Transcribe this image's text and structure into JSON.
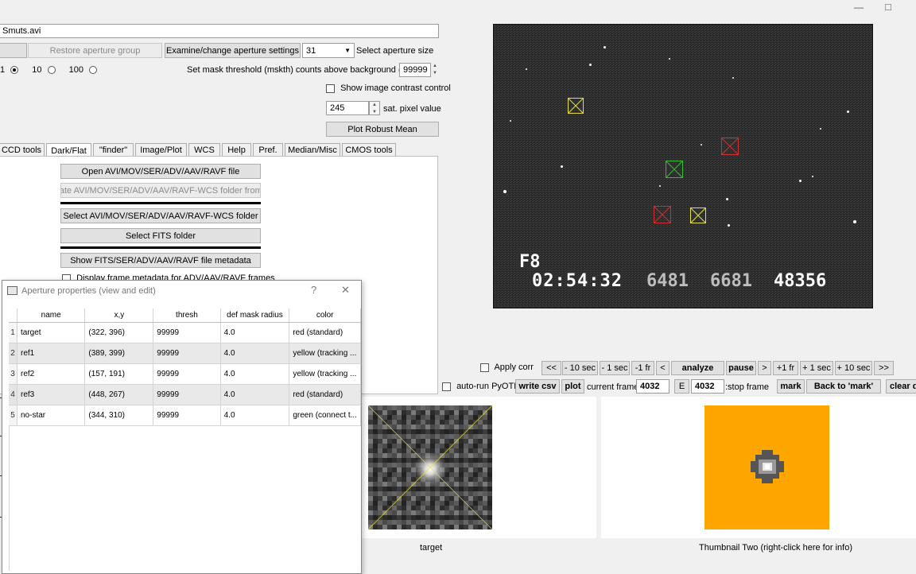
{
  "window": {
    "minimize_glyph": "—",
    "maximize_glyph": "□"
  },
  "file_field": "Smuts.avi",
  "aperture_controls": {
    "restore_group_button": "Restore aperture group",
    "examine_button": "Examine/change aperture settings",
    "size_value": "31",
    "size_label": "Select aperture size"
  },
  "scale_options": {
    "option1_label": "1",
    "option2_label": "10",
    "option3_label": "100",
    "selected": "1"
  },
  "mask": {
    "label": "Set mask threshold (mskth) counts above background (bkavg)",
    "value": "99999"
  },
  "contrast_checkbox_label": "Show image contrast control",
  "saturation": {
    "value": "245",
    "label": "sat. pixel value"
  },
  "plot_robust_mean_button": "Plot Robust Mean",
  "tabs": [
    {
      "label": "CCD tools"
    },
    {
      "label": "Dark/Flat"
    },
    {
      "label": "\"finder\""
    },
    {
      "label": "Image/Plot"
    },
    {
      "label": "WCS"
    },
    {
      "label": "Help"
    },
    {
      "label": "Pref."
    },
    {
      "label": "Median/Misc"
    },
    {
      "label": "CMOS tools"
    }
  ],
  "file_panel": {
    "open_button": "Open AVI/MOV/SER/ADV/AAV/RAVF file",
    "create_wcs_button": "Create AVI/MOV/SER/ADV/AAV/RAVF-WCS folder from file",
    "select_folder_button": "Select AVI/MOV/SER/ADV/AAV/RAVF-WCS folder",
    "select_fits_button": "Select FITS folder",
    "show_metadata_button": "Show FITS/SER/ADV/AAV/RAVF file metadata",
    "display_metadata_checkbox": "Display frame metadata for ADV/AAV/RAVF frames"
  },
  "video_overlay": {
    "camera_id": "F8",
    "timestamp": "02:54:32",
    "field1": "6481",
    "field2": "6681",
    "field3": "48356"
  },
  "playback": {
    "apply_corr_label": "Apply corr",
    "first_button": "<<",
    "back10_button": "- 10 sec",
    "back1_button": "- 1 sec",
    "back1fr_button": "-1 fr",
    "back_button": "<",
    "analyze_button": "analyze",
    "pause_button": "pause",
    "fwd_button": ">",
    "fwd1fr_button": "+1 fr",
    "fwd1_button": "+ 1 sec",
    "fwd10_button": "+ 10 sec",
    "last_button": ">>"
  },
  "frame_controls": {
    "autorun_label": "auto-run PyOTE",
    "write_csv_button": "write csv",
    "plot_button": "plot",
    "current_frame_label": "current frame:",
    "current_frame_value": "4032",
    "e_button": "E",
    "stop_frame_value": "4032",
    "stop_frame_label": ":stop frame",
    "mark_button": "mark",
    "back_to_mark_button": "Back to 'mark'",
    "clear_button": "clear d"
  },
  "thumbnails": {
    "one_caption": "target",
    "two_caption": "Thumbnail Two (right-click here for info)",
    "two_background": "#ffa500"
  },
  "dialog": {
    "title": "Aperture properties (view and edit)",
    "help_glyph": "?",
    "close_glyph": "✕",
    "columns": [
      "name",
      "x,y",
      "thresh",
      "def mask radius",
      "color"
    ],
    "rows": [
      {
        "num": "1",
        "name": "target",
        "xy": "(322, 396)",
        "thresh": "99999",
        "radius": "4.0",
        "color": "red (standard)"
      },
      {
        "num": "2",
        "name": "ref1",
        "xy": "(389, 399)",
        "thresh": "99999",
        "radius": "4.0",
        "color": "yellow (tracking ..."
      },
      {
        "num": "3",
        "name": "ref2",
        "xy": "(157, 191)",
        "thresh": "99999",
        "radius": "4.0",
        "color": "yellow (tracking ..."
      },
      {
        "num": "4",
        "name": "ref3",
        "xy": "(448, 267)",
        "thresh": "99999",
        "radius": "4.0",
        "color": "red (standard)"
      },
      {
        "num": "5",
        "name": "no-star",
        "xy": "(344, 310)",
        "thresh": "99999",
        "radius": "4.0",
        "color": "green (connect t..."
      }
    ]
  },
  "colors": {
    "marker_red": "#d03030",
    "marker_yellow": "#e8e040",
    "marker_green": "#30c030",
    "accent_orange": "#ffa500"
  }
}
